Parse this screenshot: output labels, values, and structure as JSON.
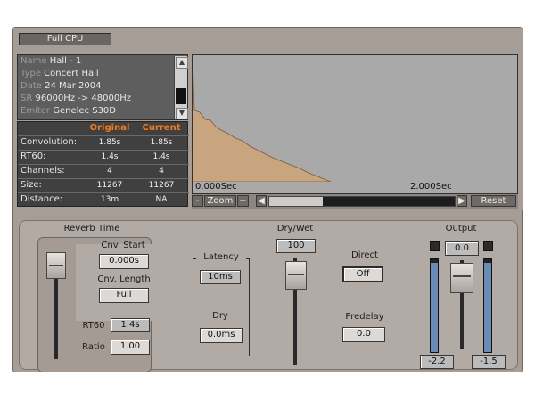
{
  "cpu_mode": "Full CPU",
  "info": [
    {
      "label": "Name",
      "value": "Hall - 1"
    },
    {
      "label": "Type",
      "value": "Concert Hall"
    },
    {
      "label": "Date",
      "value": "24 Mar 2004"
    },
    {
      "label": "SR",
      "value": "96000Hz -> 48000Hz"
    },
    {
      "label": "Emiter",
      "value": "Genelec S30D"
    }
  ],
  "stats": {
    "headers": {
      "original": "Original",
      "current": "Current"
    },
    "rows": [
      {
        "label": "Convolution:",
        "original": "1.85s",
        "current": "1.85s"
      },
      {
        "label": "RT60:",
        "original": "1.4s",
        "current": "1.4s"
      },
      {
        "label": "Channels:",
        "original": "4",
        "current": "4"
      },
      {
        "label": "Size:",
        "original": "11267",
        "current": "11267"
      },
      {
        "label": "Distance:",
        "original": "13m",
        "current": "NA"
      }
    ]
  },
  "timeline": {
    "start": "0.000Sec",
    "end": "2.000Sec"
  },
  "zoom": {
    "minus": "-",
    "label": "Zoom",
    "plus": "+"
  },
  "reset_label": "Reset",
  "reverb_time": {
    "title": "Reverb Time",
    "cnv_start_label": "Cnv. Start",
    "cnv_start_value": "0.000s",
    "cnv_length_label": "Cnv. Length",
    "cnv_length_value": "Full",
    "rt60_label": "RT60",
    "rt60_value": "1.4s",
    "ratio_label": "Ratio",
    "ratio_value": "1.00"
  },
  "latency": {
    "title": "Latency",
    "value": "10ms",
    "dry_label": "Dry",
    "dry_value": "0.0ms"
  },
  "dry_wet": {
    "title": "Dry/Wet",
    "value": "100"
  },
  "direct": {
    "title": "Direct",
    "value": "Off"
  },
  "predelay": {
    "title": "Predelay",
    "value": "0.0"
  },
  "output": {
    "title": "Output",
    "value": "0.0",
    "left_value": "-2.2",
    "right_value": "-1.5"
  },
  "colors": {
    "accent": "#f07a1e",
    "ir_fill": "#c9a57f"
  }
}
